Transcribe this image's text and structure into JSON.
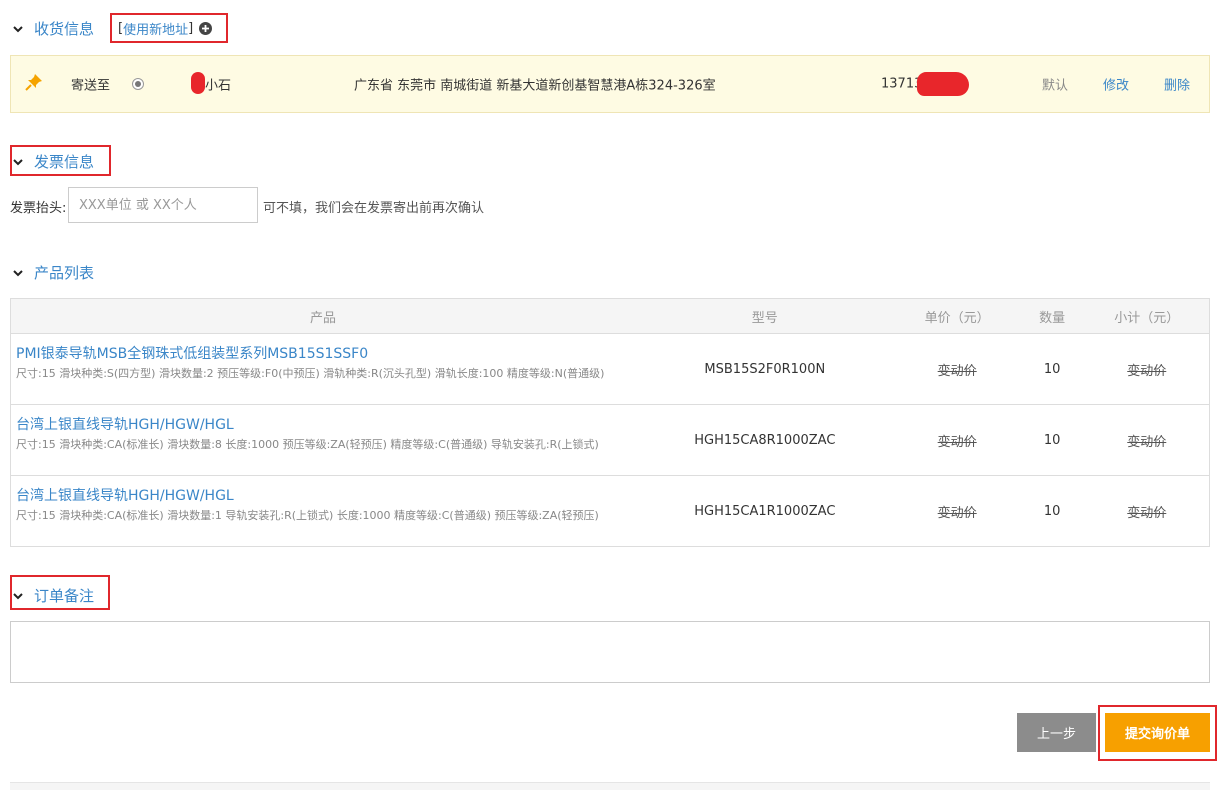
{
  "shipping": {
    "title": "收货信息",
    "new_address_label": "使用新地址",
    "bracket_open": "[",
    "bracket_close": "]",
    "address": {
      "ship_to_label": "寄送至",
      "recipient": "小石",
      "full_address": "广东省 东莞市 南城街道 新基大道新创基智慧港A栋324-326室",
      "phone": "13713",
      "default_label": "默认",
      "edit_label": "修改",
      "delete_label": "删除"
    }
  },
  "invoice": {
    "title": "发票信息",
    "header_label": "发票抬头:",
    "header_placeholder": "XXX单位 或 XX个人",
    "header_value": "",
    "hint": "可不填，我们会在发票寄出前再次确认"
  },
  "products": {
    "title": "产品列表",
    "columns": [
      "产品",
      "型号",
      "单价（元）",
      "数量",
      "小计（元）"
    ],
    "rows": [
      {
        "name": "PMI银泰导轨MSB全钢珠式低组装型系列MSB15S1SSF0",
        "spec": "尺寸:15 滑块种类:S(四方型) 滑块数量:2 预压等级:F0(中预压) 滑轨种类:R(沉头孔型) 滑轨长度:100 精度等级:N(普通级)",
        "model": "MSB15S2F0R100N",
        "unit_price": "变动价",
        "qty": "10",
        "subtotal": "变动价"
      },
      {
        "name": "台湾上银直线导轨HGH/HGW/HGL",
        "spec": "尺寸:15 滑块种类:CA(标准长) 滑块数量:8 长度:1000 预压等级:ZA(轻预压) 精度等级:C(普通级) 导轨安装孔:R(上锁式)",
        "model": "HGH15CA8R1000ZAC",
        "unit_price": "变动价",
        "qty": "10",
        "subtotal": "变动价"
      },
      {
        "name": "台湾上银直线导轨HGH/HGW/HGL",
        "spec": "尺寸:15 滑块种类:CA(标准长) 滑块数量:1 导轨安装孔:R(上锁式) 长度:1000 精度等级:C(普通级) 预压等级:ZA(轻预压)",
        "model": "HGH15CA1R1000ZAC",
        "unit_price": "变动价",
        "qty": "10",
        "subtotal": "变动价"
      }
    ]
  },
  "remarks": {
    "title": "订单备注",
    "value": ""
  },
  "actions": {
    "prev_label": "上一步",
    "submit_label": "提交询价单"
  },
  "colors": {
    "link": "#3a86c8",
    "highlight_box": "#e0272c",
    "submit": "#f7a000",
    "prev": "#8c8c8c",
    "address_bg": "#fefbe3"
  }
}
